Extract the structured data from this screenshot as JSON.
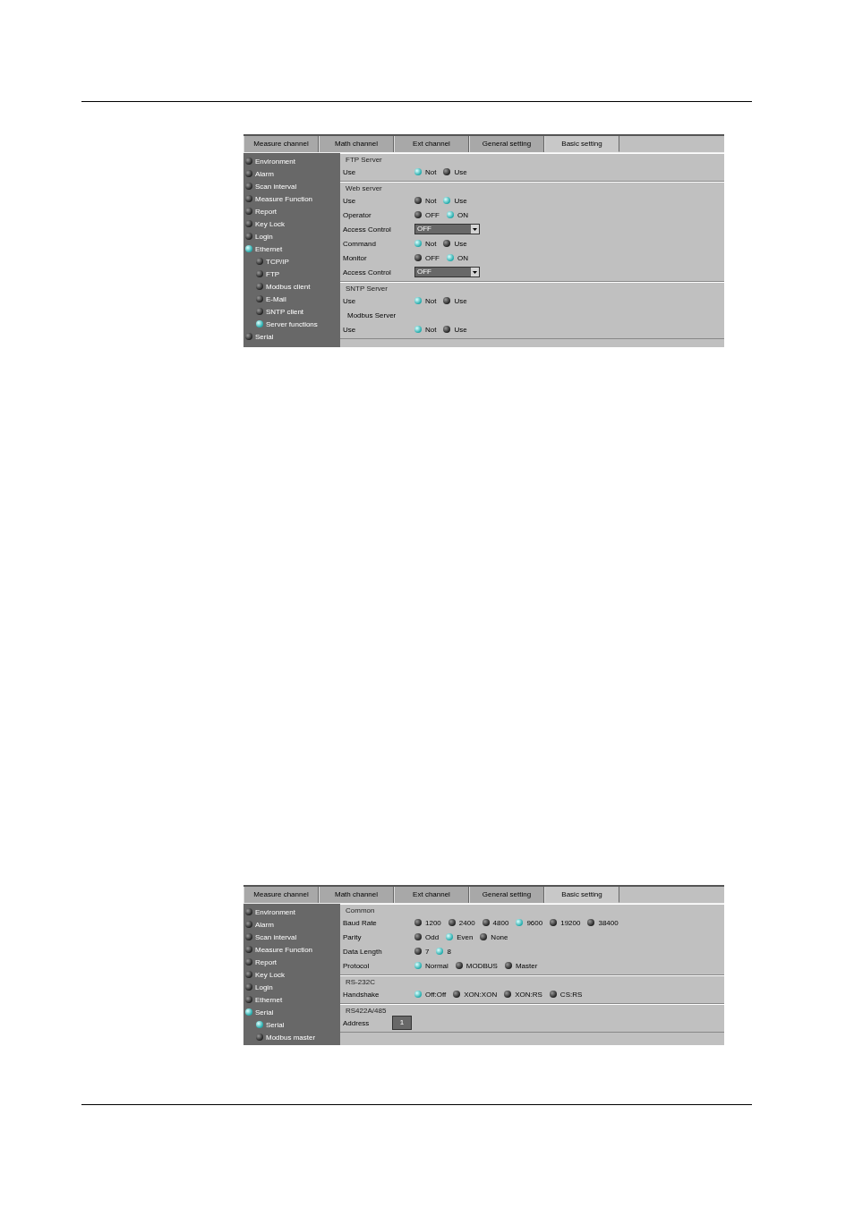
{
  "screens": [
    {
      "tabs": [
        {
          "label": "Measure channel",
          "selected": false
        },
        {
          "label": "Math channel",
          "selected": false
        },
        {
          "label": "Ext channel",
          "selected": false
        },
        {
          "label": "General setting",
          "selected": false
        },
        {
          "label": "Basic setting",
          "selected": true
        }
      ],
      "sidebar": {
        "items": [
          {
            "label": "Environment",
            "selected": false
          },
          {
            "label": "Alarm",
            "selected": false
          },
          {
            "label": "Scan interval",
            "selected": false
          },
          {
            "label": "Measure Function",
            "selected": false
          },
          {
            "label": "Report",
            "selected": false
          },
          {
            "label": "Key Lock",
            "selected": false
          },
          {
            "label": "Login",
            "selected": false
          },
          {
            "label": "Ethernet",
            "selected": true,
            "children": [
              {
                "label": "TCP/IP",
                "selected": false
              },
              {
                "label": "FTP",
                "selected": false
              },
              {
                "label": "Modbus client",
                "selected": false
              },
              {
                "label": "E-Mail",
                "selected": false
              },
              {
                "label": "SNTP client",
                "selected": false
              },
              {
                "label": "Server functions",
                "selected": true
              }
            ]
          },
          {
            "label": "Serial",
            "selected": false
          }
        ]
      },
      "sections": [
        {
          "title": "FTP Server",
          "rows": [
            {
              "kind": "radio",
              "label": "Use",
              "options": [
                {
                  "label": "Not",
                  "selected": true
                },
                {
                  "label": "Use",
                  "selected": false
                }
              ]
            }
          ]
        },
        {
          "title": "Web server",
          "rows": [
            {
              "kind": "radio",
              "label": "Use",
              "options": [
                {
                  "label": "Not",
                  "selected": false
                },
                {
                  "label": "Use",
                  "selected": true
                }
              ]
            },
            {
              "kind": "radio",
              "label": "Operator",
              "options": [
                {
                  "label": "OFF",
                  "selected": false
                },
                {
                  "label": "ON",
                  "selected": true
                }
              ]
            },
            {
              "kind": "select",
              "label": "Access Control",
              "value": "OFF"
            },
            {
              "kind": "radio",
              "label": "Command",
              "options": [
                {
                  "label": "Not",
                  "selected": true
                },
                {
                  "label": "Use",
                  "selected": false
                }
              ]
            },
            {
              "kind": "radio",
              "label": "Monitor",
              "options": [
                {
                  "label": "OFF",
                  "selected": false
                },
                {
                  "label": "ON",
                  "selected": true
                }
              ]
            },
            {
              "kind": "select",
              "label": "Access Control",
              "value": "OFF"
            }
          ]
        },
        {
          "title": "SNTP Server",
          "rows": [
            {
              "kind": "radio",
              "label": "Use",
              "options": [
                {
                  "label": "Not",
                  "selected": true
                },
                {
                  "label": "Use",
                  "selected": false
                }
              ]
            },
            {
              "kind": "subheading",
              "label": "Modbus Server"
            },
            {
              "kind": "radio",
              "label": "Use",
              "options": [
                {
                  "label": "Not",
                  "selected": true
                },
                {
                  "label": "Use",
                  "selected": false
                }
              ]
            }
          ]
        }
      ]
    },
    {
      "tabs": [
        {
          "label": "Measure channel",
          "selected": false
        },
        {
          "label": "Math channel",
          "selected": false
        },
        {
          "label": "Ext channel",
          "selected": false
        },
        {
          "label": "General setting",
          "selected": false
        },
        {
          "label": "Basic setting",
          "selected": true
        }
      ],
      "sidebar": {
        "items": [
          {
            "label": "Environment",
            "selected": false
          },
          {
            "label": "Alarm",
            "selected": false
          },
          {
            "label": "Scan interval",
            "selected": false
          },
          {
            "label": "Measure Function",
            "selected": false
          },
          {
            "label": "Report",
            "selected": false
          },
          {
            "label": "Key Lock",
            "selected": false
          },
          {
            "label": "Login",
            "selected": false
          },
          {
            "label": "Ethernet",
            "selected": false
          },
          {
            "label": "Serial",
            "selected": true,
            "children": [
              {
                "label": "Serial",
                "selected": true
              },
              {
                "label": "Modbus master",
                "selected": false
              }
            ]
          }
        ]
      },
      "sections": [
        {
          "title": "Common",
          "rows": [
            {
              "kind": "radio",
              "label": "Baud Rate",
              "options": [
                {
                  "label": "1200",
                  "selected": false
                },
                {
                  "label": "2400",
                  "selected": false
                },
                {
                  "label": "4800",
                  "selected": false
                },
                {
                  "label": "9600",
                  "selected": true
                },
                {
                  "label": "19200",
                  "selected": false
                },
                {
                  "label": "38400",
                  "selected": false
                }
              ]
            },
            {
              "kind": "radio",
              "label": "Parity",
              "options": [
                {
                  "label": "Odd",
                  "selected": false
                },
                {
                  "label": "Even",
                  "selected": true
                },
                {
                  "label": "None",
                  "selected": false
                }
              ]
            },
            {
              "kind": "radio",
              "label": "Data Length",
              "options": [
                {
                  "label": "7",
                  "selected": false
                },
                {
                  "label": "8",
                  "selected": true
                }
              ]
            },
            {
              "kind": "radio",
              "label": "Protocol",
              "options": [
                {
                  "label": "Normal",
                  "selected": true
                },
                {
                  "label": "MODBUS",
                  "selected": false
                },
                {
                  "label": "Master",
                  "selected": false
                }
              ]
            }
          ]
        },
        {
          "title": "RS-232C",
          "rows": [
            {
              "kind": "radio",
              "label": "Handshake",
              "options": [
                {
                  "label": "Off:Off",
                  "selected": true
                },
                {
                  "label": "XON:XON",
                  "selected": false
                },
                {
                  "label": "XON:RS",
                  "selected": false
                },
                {
                  "label": "CS:RS",
                  "selected": false
                }
              ]
            }
          ]
        },
        {
          "title": "RS422A/485",
          "rows": [
            {
              "kind": "input",
              "label": "Address",
              "value": "1"
            }
          ]
        }
      ]
    }
  ]
}
